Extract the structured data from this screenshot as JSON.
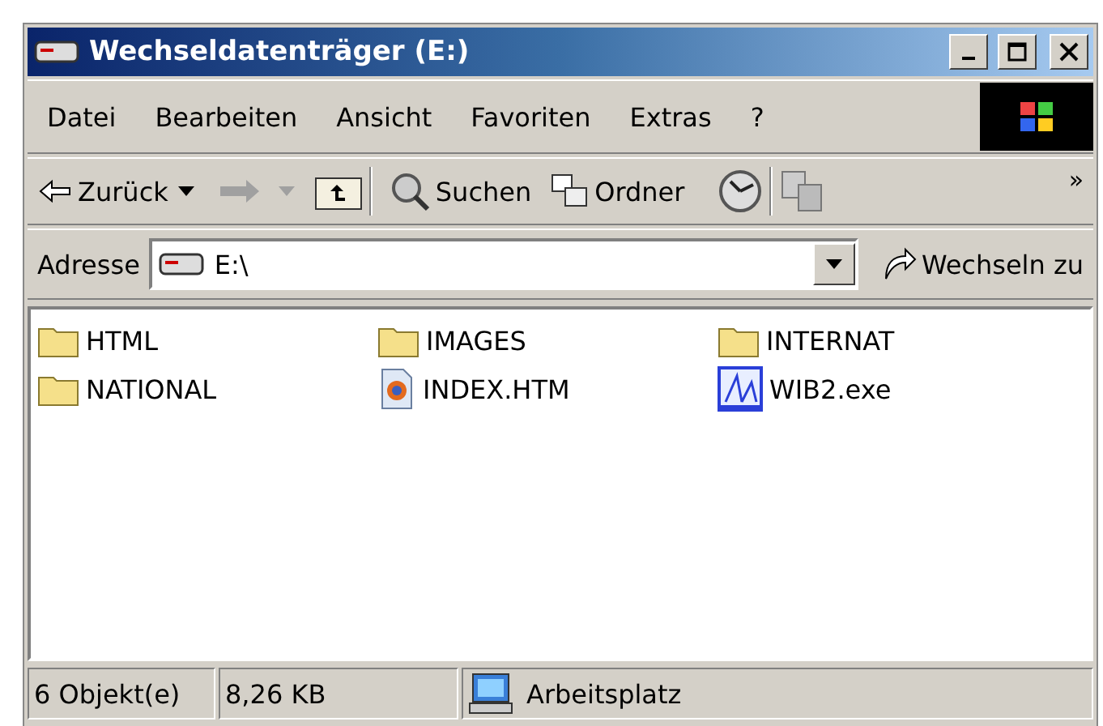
{
  "window": {
    "title": "Wechseldatenträger (E:)"
  },
  "menu": [
    "Datei",
    "Bearbeiten",
    "Ansicht",
    "Favoriten",
    "Extras",
    "?"
  ],
  "toolbar": {
    "back": "Zurück",
    "search": "Suchen",
    "folders": "Ordner",
    "more": "»"
  },
  "address": {
    "label": "Adresse",
    "value": "E:\\",
    "go": "Wechseln zu"
  },
  "files": [
    {
      "name": "HTML",
      "kind": "folder"
    },
    {
      "name": "IMAGES",
      "kind": "folder"
    },
    {
      "name": "INTERNAT",
      "kind": "folder"
    },
    {
      "name": "NATIONAL",
      "kind": "folder"
    },
    {
      "name": "INDEX.HTM",
      "kind": "html"
    },
    {
      "name": "WIB2.exe",
      "kind": "exe"
    }
  ],
  "status_bar": {
    "count": "6 Objekt(e)",
    "size": "8,26 KB",
    "zone": "Arbeitsplatz"
  }
}
